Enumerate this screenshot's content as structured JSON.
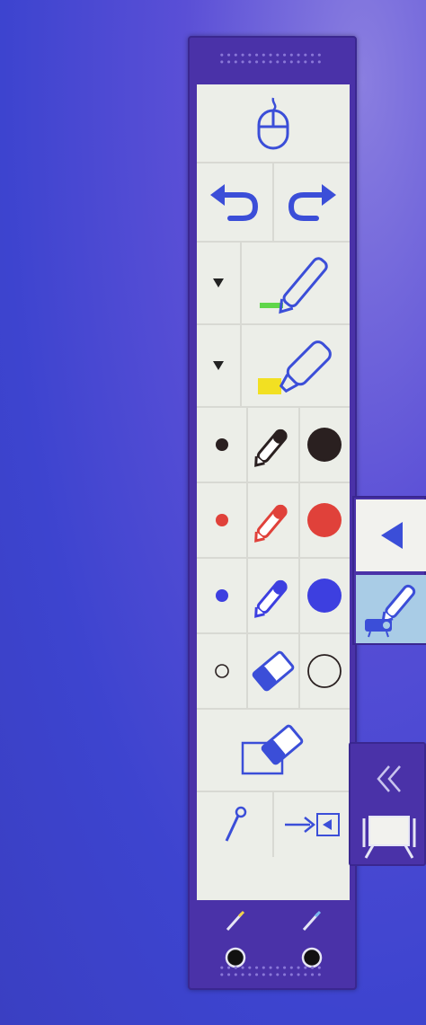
{
  "colors": {
    "background": "#3d44cf",
    "toolbar": "#4a32a8",
    "panel": "#eceee8",
    "icon_blue": "#3b4ed8",
    "black_pen": "#2a2020",
    "red_pen": "#e0413a",
    "blue_pen": "#3d3fe0",
    "green_highlight": "#5fd64a",
    "yellow_highlight": "#f2e022",
    "active_mode": "#a9cce6"
  },
  "toolbar": {
    "rows": [
      {
        "name": "mouse-mode",
        "icons": [
          "mouse-icon"
        ]
      },
      {
        "name": "undo-redo",
        "icons": [
          "undo-icon",
          "redo-icon"
        ]
      },
      {
        "name": "pen",
        "icons": [
          "dropdown-arrow-icon",
          "pen-icon"
        ]
      },
      {
        "name": "highlighter",
        "icons": [
          "dropdown-arrow-icon",
          "highlighter-icon"
        ]
      },
      {
        "name": "black-pen",
        "icons": [
          "small-dot-icon",
          "pen-icon",
          "large-dot-icon"
        ]
      },
      {
        "name": "red-pen",
        "icons": [
          "small-dot-icon",
          "pen-icon",
          "large-dot-icon"
        ]
      },
      {
        "name": "blue-pen",
        "icons": [
          "small-dot-icon",
          "pen-icon",
          "large-dot-icon"
        ]
      },
      {
        "name": "eraser",
        "icons": [
          "small-circle-icon",
          "eraser-icon",
          "large-circle-icon"
        ]
      },
      {
        "name": "clear-screen",
        "icons": [
          "clear-screen-icon"
        ]
      },
      {
        "name": "pin-exit",
        "icons": [
          "pin-icon",
          "exit-icon"
        ]
      }
    ],
    "bottom_icons": [
      "pen-icon",
      "pen-icon",
      "pen-tip-icon",
      "pen-tip-icon"
    ]
  },
  "side_panel": {
    "top_icons": [
      "triangle-left-icon",
      "projector-pen-icon"
    ],
    "bottom_icons": [
      "double-chevron-left-icon",
      "screen-frame-icon"
    ]
  }
}
